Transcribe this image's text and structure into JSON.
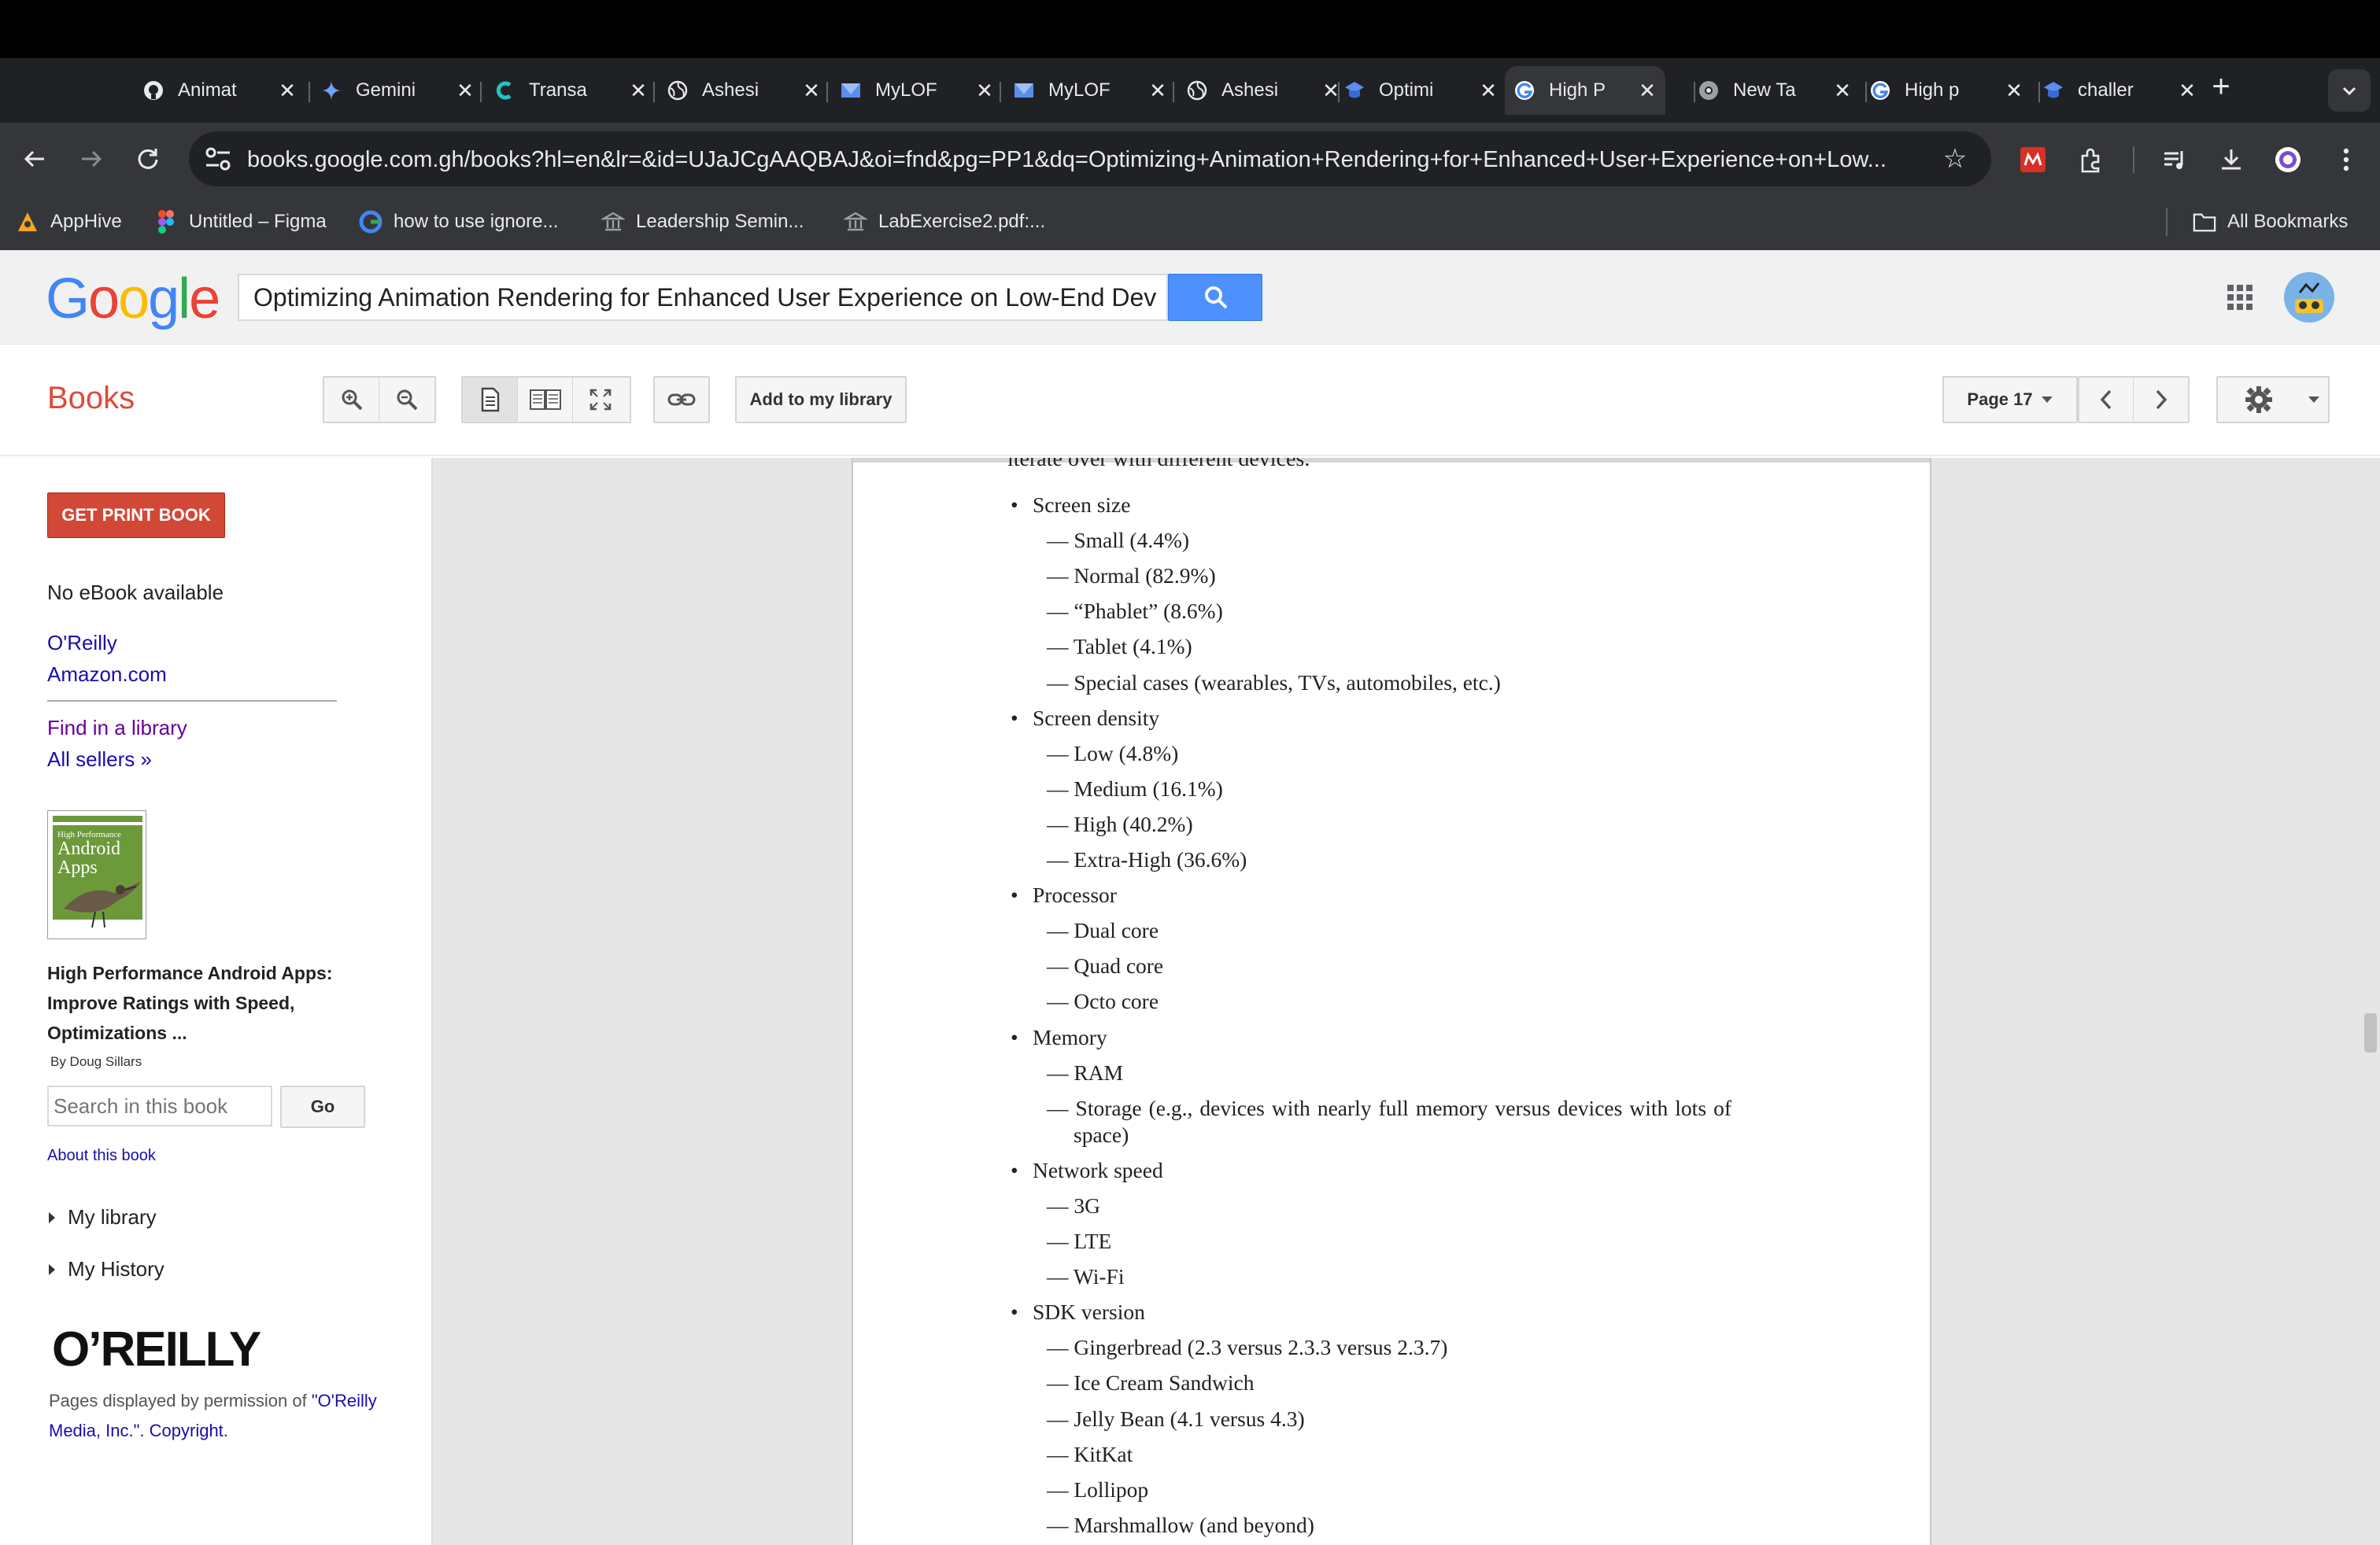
{
  "browser": {
    "tabs": [
      {
        "label": "Animat",
        "icon": "github-icon"
      },
      {
        "label": "Gemini",
        "icon": "gemini-icon"
      },
      {
        "label": "Transa",
        "icon": "transa-icon"
      },
      {
        "label": "Ashesi",
        "icon": "globe-icon"
      },
      {
        "label": "MyLOF",
        "icon": "mylof-icon"
      },
      {
        "label": "MyLOF",
        "icon": "mylof-icon"
      },
      {
        "label": "Ashesi",
        "icon": "globe-icon"
      },
      {
        "label": "Optimi",
        "icon": "optimi-icon"
      },
      {
        "label": "High P",
        "icon": "google-icon",
        "active": true
      },
      {
        "label": "New Ta",
        "icon": "chrome-icon"
      },
      {
        "label": "High p",
        "icon": "google-icon"
      },
      {
        "label": "challer",
        "icon": "optimi-icon"
      }
    ],
    "close_glyph": "✕",
    "new_tab": "+",
    "url": "books.google.com.gh/books?hl=en&lr=&id=UJaJCgAAQBAJ&oi=fnd&pg=PP1&dq=Optimizing+Animation+Rendering+for+Enhanced+User+Experience+on+Low...",
    "bookmarks": [
      {
        "label": "AppHive",
        "icon": "apphive-icon"
      },
      {
        "label": "Untitled – Figma",
        "icon": "figma-icon"
      },
      {
        "label": "how to use ignore...",
        "icon": "google-icon"
      },
      {
        "label": "Leadership Semin...",
        "icon": "institution-icon"
      },
      {
        "label": "LabExercise2.pdf:...",
        "icon": "institution-icon"
      }
    ],
    "all_bookmarks": "All Bookmarks"
  },
  "google": {
    "logo_letters": [
      "G",
      "o",
      "o",
      "g",
      "l",
      "e"
    ],
    "logo_colors": [
      "#4285f4",
      "#ea4335",
      "#fbbc05",
      "#4285f4",
      "#34a853",
      "#ea4335"
    ],
    "search_value": "Optimizing Animation Rendering for Enhanced User Experience on Low-End Dev"
  },
  "books_toolbar": {
    "title": "Books",
    "add_library": "Add to my library",
    "page_label": "Page 17"
  },
  "sidebar": {
    "print_button": "GET PRINT BOOK",
    "no_ebook": "No eBook available",
    "sellers": [
      "O'Reilly",
      "Amazon.com"
    ],
    "find_library": "Find in a library",
    "all_sellers": "All sellers »",
    "cover_line1": "High Performance",
    "cover_line2": "Android",
    "cover_line3": "Apps",
    "book_title": "High Performance Android Apps: Improve Ratings with Speed, Optimizations ...",
    "author": "By Doug Sillars",
    "search_placeholder": "Search in this book",
    "go": "Go",
    "about": "About this book",
    "my_library": "My library",
    "my_history": "My History",
    "publisher_logo": "O’REILLY",
    "permission_prefix": "Pages displayed by permission of ",
    "permission_link": "\"O'Reilly Media, Inc.\". Copyright."
  },
  "page": {
    "cut_line": "iterate over with different devices.",
    "lines": [
      {
        "type": "bullet",
        "text": "Screen size"
      },
      {
        "type": "sub",
        "text": "— Small (4.4%)"
      },
      {
        "type": "sub",
        "text": "— Normal (82.9%)"
      },
      {
        "type": "sub",
        "text": "— “Phablet” (8.6%)"
      },
      {
        "type": "sub",
        "text": "— Tablet (4.1%)"
      },
      {
        "type": "sub",
        "text": "— Special cases (wearables, TVs, automobiles, etc.)"
      },
      {
        "type": "bullet",
        "text": "Screen density"
      },
      {
        "type": "sub",
        "text": "— Low (4.8%)"
      },
      {
        "type": "sub",
        "text": "— Medium (16.1%)"
      },
      {
        "type": "sub",
        "text": "— High (40.2%)"
      },
      {
        "type": "sub",
        "text": "— Extra-High (36.6%)"
      },
      {
        "type": "bullet",
        "text": "Processor"
      },
      {
        "type": "sub",
        "text": "— Dual core"
      },
      {
        "type": "sub",
        "text": "— Quad core"
      },
      {
        "type": "sub",
        "text": "— Octo core"
      },
      {
        "type": "bullet",
        "text": "Memory"
      },
      {
        "type": "sub",
        "text": "— RAM"
      },
      {
        "type": "sub-wrap",
        "text": "— Storage (e.g., devices with nearly full memory versus devices with lots of",
        "cont": "space)"
      },
      {
        "type": "bullet",
        "text": "Network speed"
      },
      {
        "type": "sub",
        "text": "— 3G"
      },
      {
        "type": "sub",
        "text": "— LTE"
      },
      {
        "type": "sub",
        "text": "— Wi-Fi"
      },
      {
        "type": "bullet",
        "text": "SDK version"
      },
      {
        "type": "sub",
        "text": "— Gingerbread (2.3 versus 2.3.3 versus 2.3.7)"
      },
      {
        "type": "sub",
        "text": "— Ice Cream Sandwich"
      },
      {
        "type": "sub",
        "text": "— Jelly Bean (4.1 versus 4.3)"
      },
      {
        "type": "sub",
        "text": "— KitKat"
      },
      {
        "type": "sub",
        "text": "— Lollipop"
      },
      {
        "type": "sub",
        "text": "— Marshmallow (and beyond)"
      }
    ]
  }
}
